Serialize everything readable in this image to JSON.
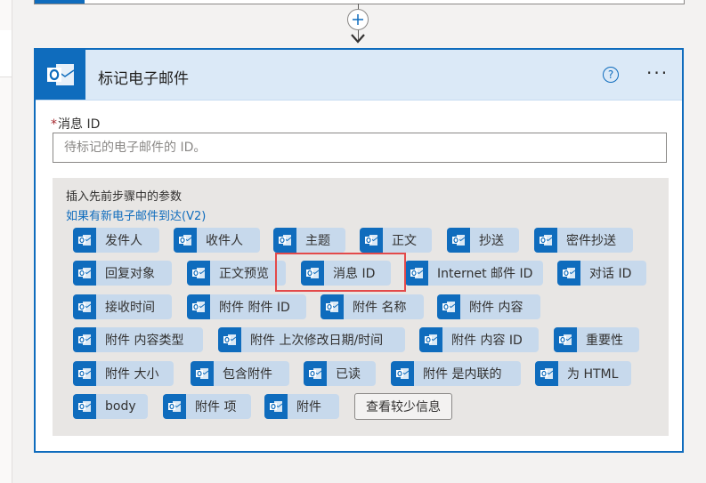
{
  "card": {
    "title": "标记电子邮件",
    "help_glyph": "?",
    "more_glyph": "···"
  },
  "field": {
    "required_mark": "*",
    "label": "消息 ID",
    "placeholder": "待标记的电子邮件的 ID。",
    "value": ""
  },
  "dynamic_content": {
    "title": "插入先前步骤中的参数",
    "source_link": "如果有新电子邮件到达(V2)",
    "tokens": [
      "发件人",
      "收件人",
      "主题",
      "正文",
      "抄送",
      "密件抄送",
      "回复对象",
      "正文预览",
      "消息 ID",
      "Internet 邮件 ID",
      "对话 ID",
      "接收时间",
      "附件 附件 ID",
      "附件 名称",
      "附件 内容",
      "附件 内容类型",
      "附件 上次修改日期/时间",
      "附件 内容 ID",
      "重要性",
      "附件 大小",
      "包含附件",
      "已读",
      "附件 是内联的",
      "为 HTML",
      "body",
      "附件 项",
      "附件"
    ],
    "show_less_label": "查看较少信息"
  },
  "colors": {
    "accent": "#0f6cbd",
    "token_bg": "#c7d9ec",
    "highlight": "#e34a4a"
  },
  "icons": {
    "add": "plus-icon",
    "connector": "arrow-down-icon",
    "app": "outlook-icon",
    "help": "help-icon",
    "more": "more-icon"
  }
}
